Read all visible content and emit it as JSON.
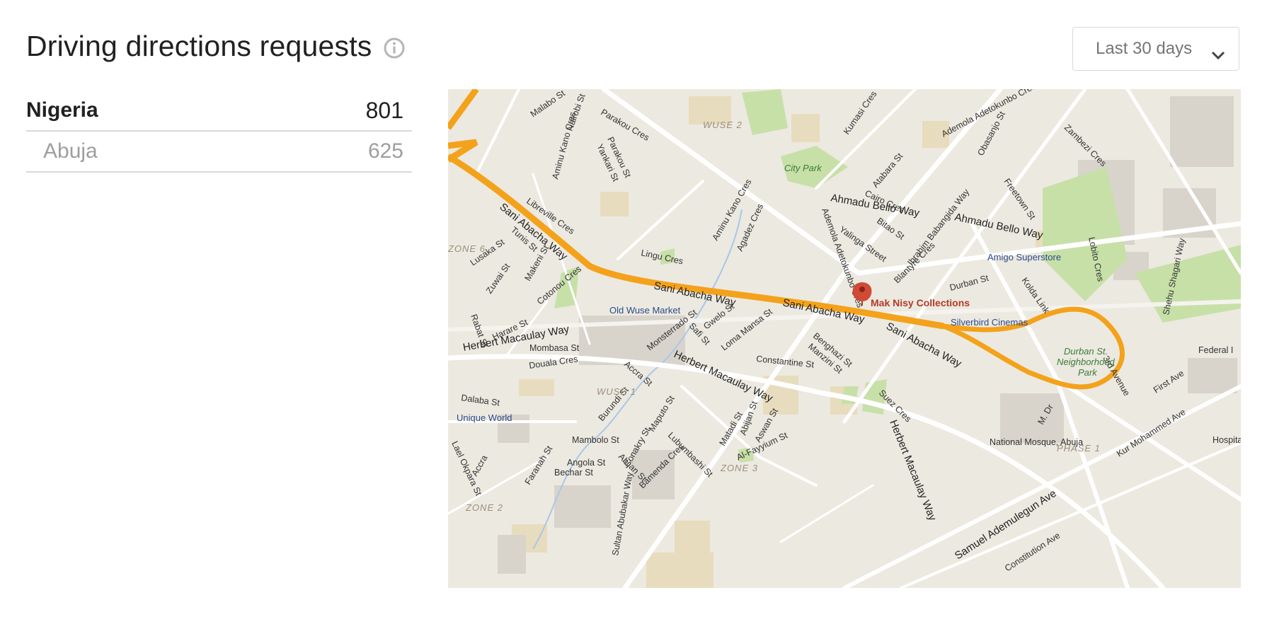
{
  "header": {
    "title": "Driving directions requests",
    "info_icon": "info-icon"
  },
  "date_range": {
    "selected": "Last 30 days",
    "icon": "chevron-down-icon"
  },
  "stats": {
    "country": {
      "name": "Nigeria",
      "value": "801"
    },
    "city": {
      "name": "Abuja",
      "value": "625"
    }
  },
  "map": {
    "marker_label": "Mak Nisy Collections",
    "route_color": "#f4a21b",
    "marker_color": "#d04a35",
    "streets": {
      "sani_abacha_1": "Sani Abacha Way",
      "sani_abacha_2": "Sani Abacha Way",
      "sani_abacha_3": "Sani Abacha Way",
      "sani_abacha_4": "Sani Abacha Way",
      "herbert_1": "Herbert Macaulay Way",
      "herbert_2": "Herbert Macaulay Way",
      "herbert_3": "Herbert Macaulay Way",
      "ahmadu_1": "Ahmadu Bello Way",
      "ahmadu_2": "Ahmadu Bello Way",
      "ibrahim": "Ibrahim Babangida Way",
      "ademola_1": "Ademola Adetokunbo Cres",
      "ademola_2": "Ademola Adetokunbo Cres",
      "aminu_1": "Aminu Kano Cres",
      "aminu_2": "Aminu Kano Cres",
      "sultan": "Sultan Abubakar Way",
      "samuel": "Samuel Ademulegun Ave",
      "constitution": "Constitution Ave",
      "kur": "Kur Mohammed Ave",
      "third_ave": "3rd Avenue",
      "first_ave": "First Ave",
      "shehu": "Shehu Shagari Way",
      "mdr": "M. Dr",
      "malabo": "Malabo St",
      "parakou_cres": "Parakou Cres",
      "nairobi": "Nairobi St",
      "parakou_st": "Parakou St",
      "yankari": "Yankari St",
      "libreville": "Libreville Cres",
      "tunis": "Tunis St",
      "lusaka": "Lusaka St",
      "zuwai": "Zuwai St",
      "makeni": "Makeni St",
      "cotonou": "Cotonou Cres",
      "rabat": "Rabat St",
      "harare": "Harare St",
      "mombasa": "Mombasa St",
      "douala": "Douala Cres",
      "dalaba": "Dalaba St",
      "lingu": "Lingu Cres",
      "agadez": "Agadez Cres",
      "kumasi": "Kumasi Cres",
      "atabara": "Atabara St",
      "cairo": "Cairo Cres",
      "bitao": "Bitao St",
      "yalinga": "Yalinga Street",
      "obasanjo": "Obasanjo St",
      "freetown": "Freetown St",
      "zambezi": "Zambezi Cres",
      "blantyre": "Blantyre Cres",
      "durban": "Durban St",
      "kolda": "Kolda Link",
      "lobito": "Lobito Cres",
      "monsterrado": "Monsterrado St",
      "safi": "Safi St",
      "gwelo": "Gwelo St",
      "loma": "Loma Mansa St",
      "benghazi": "Benghazi St",
      "manzini": "Manzini St",
      "constantine": "Constantine St",
      "accra_1": "Accra St",
      "accra_2": "Accra",
      "burundi": "Burundi St",
      "maputo": "Maputo St",
      "lubumbashi": "Lubumbashi St",
      "matadi": "Matadi St",
      "abijan_1": "Abijan St",
      "abijan_2": "Abijan St",
      "aswan": "Aswan St",
      "al_fayyium": "Al-Fayyium St",
      "suez": "Suez Cres",
      "mambolo": "Mambolo St",
      "angola": "Angola St",
      "bechar": "Bechar St",
      "faranah": "Faranah St",
      "bamenda": "Bamenda Cres",
      "conakry": "Conakry St",
      "ejike": "Lael Okpara St"
    },
    "zones": {
      "wuse2": "WUSE 2",
      "zone6": "ZONE 6",
      "wuse1": "WUSE 1",
      "zone3": "ZONE 3",
      "zone2": "ZONE 2",
      "phase1": "PHASE 1"
    },
    "places": {
      "city_park": "City Park",
      "amigo": "Amigo Superstore",
      "old_wuse": "Old Wuse Market",
      "silverbird": "Silverbird Cinemas",
      "durban_park_1": "Durban St.",
      "durban_park_2": "Neighborhood",
      "durban_park_3": "Park",
      "federal": "Federal I",
      "hospital": "Hospital",
      "unique_world": "Unique World",
      "mosque": "National Mosque, Abuja"
    }
  }
}
